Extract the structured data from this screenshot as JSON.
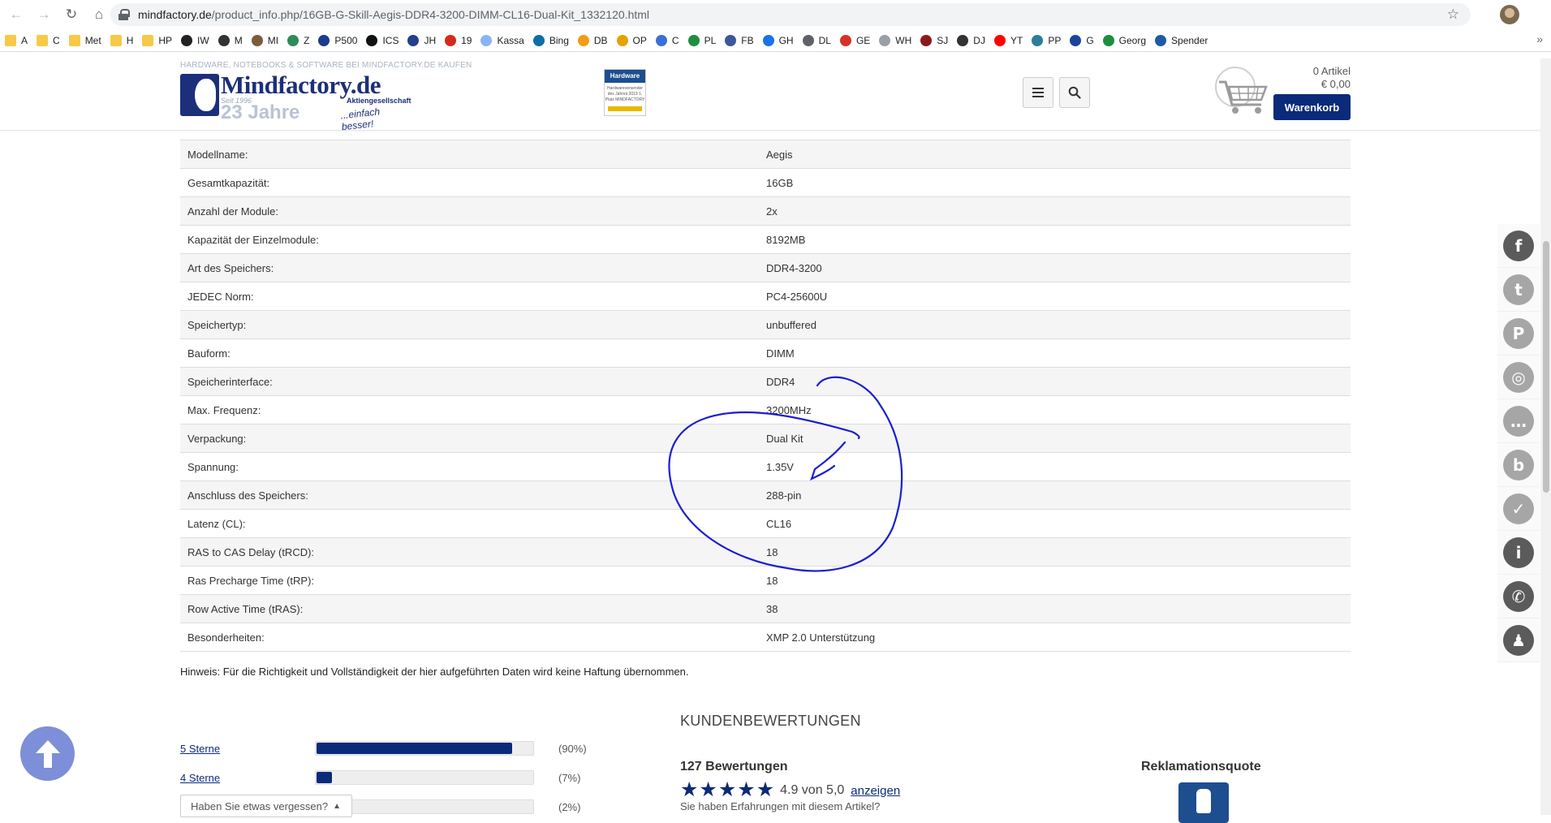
{
  "browser": {
    "url_host": "mindfactory.de",
    "url_path": "/product_info.php/16GB-G-Skill-Aegis-DDR4-3200-DIMM-CL16-Dual-Kit_1332120.html",
    "bookmarks": [
      {
        "label": "A",
        "icon": "folder"
      },
      {
        "label": "C",
        "icon": "folder"
      },
      {
        "label": "Met",
        "icon": "folder"
      },
      {
        "label": "H",
        "icon": "folder"
      },
      {
        "label": "HP",
        "icon": "folder"
      },
      {
        "label": "IW",
        "icon": "p-logo",
        "color": "#222222"
      },
      {
        "label": "M",
        "icon": "shield",
        "color": "#333333"
      },
      {
        "label": "MI",
        "icon": "mi-logo",
        "color": "#7b5b3a"
      },
      {
        "label": "Z",
        "icon": "z-logo",
        "color": "#2e8b57"
      },
      {
        "label": "P500",
        "icon": "p500-logo",
        "color": "#1a3d8f"
      },
      {
        "label": "ICS",
        "icon": "info-i",
        "color": "#111111"
      },
      {
        "label": "JH",
        "icon": "shield",
        "color": "#23408e"
      },
      {
        "label": "19",
        "icon": "flag-at",
        "color": "#d52b1e"
      },
      {
        "label": "Kassa",
        "icon": "kassa-logo",
        "color": "#8ab4f8"
      },
      {
        "label": "Bing",
        "icon": "bing-logo",
        "color": "#0f6ea8"
      },
      {
        "label": "DB",
        "icon": "db-logo",
        "color": "#f39c12"
      },
      {
        "label": "OP",
        "icon": "op-logo",
        "color": "#e6a100"
      },
      {
        "label": "C",
        "icon": "c-logo",
        "color": "#3b6fd8"
      },
      {
        "label": "PL",
        "icon": "pl-logo",
        "color": "#1e8e3e"
      },
      {
        "label": "FB",
        "icon": "facebook",
        "color": "#3b5998"
      },
      {
        "label": "GH",
        "icon": "g-logo",
        "color": "#1a73e8"
      },
      {
        "label": "DL",
        "icon": "dl-logo",
        "color": "#5f6368"
      },
      {
        "label": "GE",
        "icon": "ge-logo",
        "color": "#d93025"
      },
      {
        "label": "WH",
        "icon": "wh-logo",
        "color": "#9aa0a6"
      },
      {
        "label": "SJ",
        "icon": "sj-logo",
        "color": "#8b1a1a"
      },
      {
        "label": "DJ",
        "icon": "dj-logo",
        "color": "#333333"
      },
      {
        "label": "YT",
        "icon": "youtube",
        "color": "#ff0000"
      },
      {
        "label": "PP",
        "icon": "pp-logo",
        "color": "#2e7d9a"
      },
      {
        "label": "G",
        "icon": "gmx-logo",
        "color": "#1c449b"
      },
      {
        "label": "Georg",
        "icon": "georg-logo",
        "color": "#1e8e3e"
      },
      {
        "label": "Spender",
        "icon": "e-logo",
        "color": "#1e5aa8"
      }
    ]
  },
  "site": {
    "slogan": "HARDWARE, NOTEBOOKS & SOFTWARE BEI MINDFACTORY.DE KAUFEN",
    "logo_name": "Mindfactory.de",
    "logo_ag": "Aktiengesellschaft",
    "logo_since": "Seit 1996",
    "logo_years": "23 Jahre",
    "logo_tagline": "...einfach besser!",
    "award_title": "Hardware",
    "award_text": "Hardwareversender des Jahres 2019 1. Platz MINDFACTORY",
    "cart_count": "0 Artikel",
    "cart_total": "€ 0,00",
    "cart_button": "Warenkorb"
  },
  "specs": [
    {
      "label": "Modellname:",
      "value": "Aegis"
    },
    {
      "label": "Gesamtkapazität:",
      "value": "16GB"
    },
    {
      "label": "Anzahl der Module:",
      "value": "2x"
    },
    {
      "label": "Kapazität der Einzelmodule:",
      "value": "8192MB"
    },
    {
      "label": "Art des Speichers:",
      "value": "DDR4-3200"
    },
    {
      "label": "JEDEC Norm:",
      "value": "PC4-25600U"
    },
    {
      "label": "Speichertyp:",
      "value": "unbuffered"
    },
    {
      "label": "Bauform:",
      "value": "DIMM"
    },
    {
      "label": "Speicherinterface:",
      "value": "DDR4"
    },
    {
      "label": "Max. Frequenz:",
      "value": "3200MHz"
    },
    {
      "label": "Verpackung:",
      "value": "Dual Kit"
    },
    {
      "label": "Spannung:",
      "value": "1.35V"
    },
    {
      "label": "Anschluss des Speichers:",
      "value": "288-pin"
    },
    {
      "label": "Latenz (CL):",
      "value": "CL16"
    },
    {
      "label": "RAS to CAS Delay (tRCD):",
      "value": "18"
    },
    {
      "label": "Ras Precharge Time (tRP):",
      "value": "18"
    },
    {
      "label": "Row Active Time (tRAS):",
      "value": "38"
    },
    {
      "label": "Besonderheiten:",
      "value": "XMP 2.0 Unterstützung"
    }
  ],
  "note": "Hinweis: Für die Richtigkeit und Vollständigkeit der hier aufgeführten Daten wird keine Haftung übernommen.",
  "reviews": {
    "title": "KUNDENBEWERTUNGEN",
    "rating_rows": [
      {
        "label": "5 Sterne",
        "percent_text": "(90%)",
        "fill": 0.9
      },
      {
        "label": "4 Sterne",
        "percent_text": "(7%)",
        "fill": 0.07
      },
      {
        "label": "",
        "percent_text": "(2%)",
        "fill": 0.02
      }
    ],
    "forgot_label": "Haben Sie etwas vergessen?",
    "count_text": "127 Bewertungen",
    "stars": 5,
    "score_text": "4.9 von 5,0",
    "show_link": "anzeigen",
    "experience_text": "Sie haben Erfahrungen mit diesem Artikel?",
    "rekla_title": "Reklamationsquote"
  },
  "social": [
    "facebook-icon",
    "twitter-icon",
    "pinterest-icon",
    "instagram-icon",
    "chat-icon",
    "blog-icon",
    "check-icon",
    "info-icon",
    "phone-icon",
    "person-icon"
  ]
}
